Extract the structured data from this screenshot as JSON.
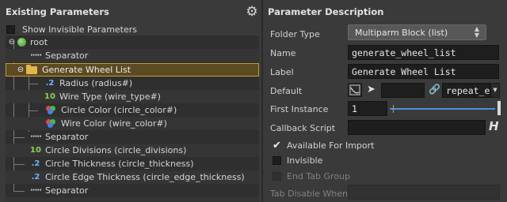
{
  "left": {
    "title": "Existing Parameters",
    "gear_icon": "gear-icon",
    "show_invisible_label": "Show Invisible Parameters",
    "show_invisible_checked": false,
    "tree": [
      {
        "label": "root",
        "kind": "root"
      },
      {
        "label": "Separator",
        "kind": "separator"
      },
      {
        "label": "Generate Wheel List",
        "kind": "folder",
        "selected": true
      },
      {
        "label": "Radius (radius#)",
        "kind": "float"
      },
      {
        "label": "Wire Type (wire_type#)",
        "kind": "int"
      },
      {
        "label": "Circle Color (circle_color#)",
        "kind": "color"
      },
      {
        "label": "Wire Color (wire_color#)",
        "kind": "color"
      },
      {
        "label": "Separator",
        "kind": "separator"
      },
      {
        "label": "Circle Divisions (circle_divisions)",
        "kind": "int"
      },
      {
        "label": "Circle Thickness (circle_thickness)",
        "kind": "float"
      },
      {
        "label": "Circle Edge Thickness (circle_edge_thickness)",
        "kind": "float"
      },
      {
        "label": "Separator",
        "kind": "separator"
      }
    ],
    "icons": {
      "separator": "·····",
      "int": "10",
      "float": ".2"
    }
  },
  "right": {
    "title": "Parameter Description",
    "folder_type_label": "Folder Type",
    "folder_type_value": "Multiparm Block (list)",
    "name_label": "Name",
    "name_value": "generate_wheel_list",
    "label_label": "Label",
    "label_value": "Generate Wheel List",
    "default_label": "Default",
    "default_value": "repeat_e",
    "first_instance_label": "First Instance",
    "first_instance_value": "1",
    "callback_label": "Callback Script",
    "callback_value": "",
    "available_import_label": "Available For Import",
    "available_import_checked": true,
    "invisible_label": "Invisible",
    "invisible_checked": false,
    "end_tab_group_label": "End Tab Group",
    "tab_disable_label": "Tab Disable When"
  }
}
